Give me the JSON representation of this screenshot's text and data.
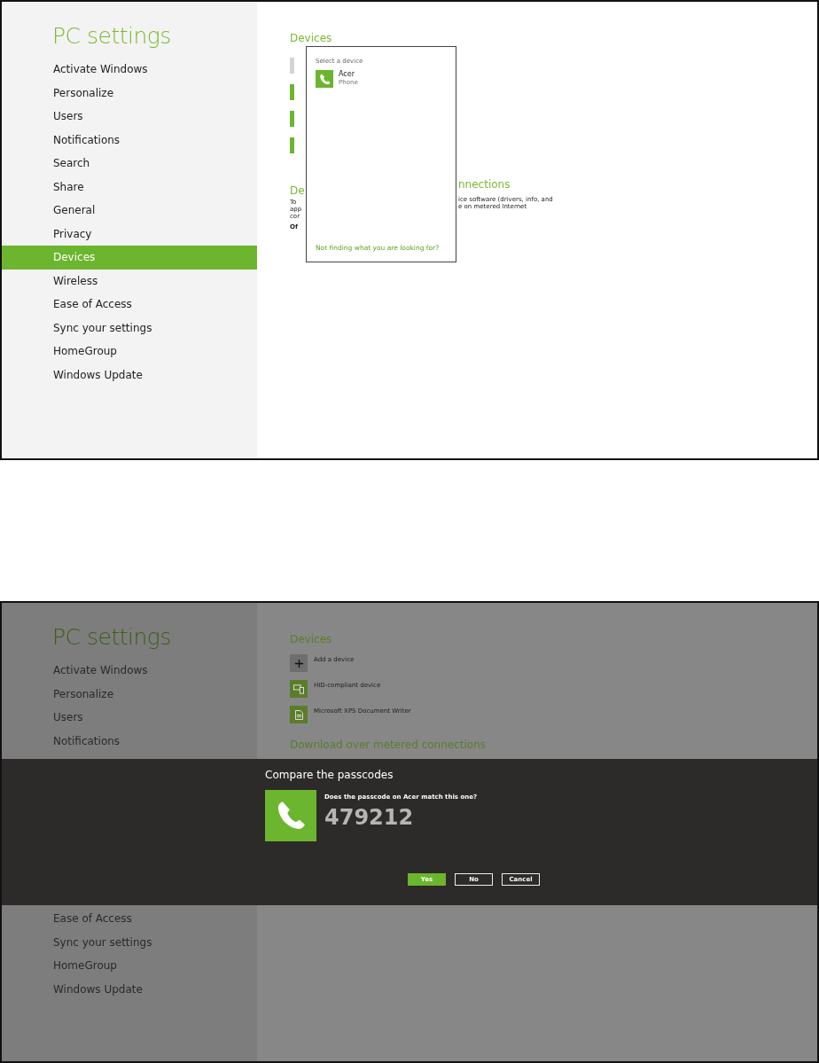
{
  "select_device_screen": {
    "title": "PC settings",
    "sidebar": {
      "items": [
        {
          "label": "Activate Windows",
          "selected": false
        },
        {
          "label": "Personalize",
          "selected": false
        },
        {
          "label": "Users",
          "selected": false
        },
        {
          "label": "Notifications",
          "selected": false
        },
        {
          "label": "Search",
          "selected": false
        },
        {
          "label": "Share",
          "selected": false
        },
        {
          "label": "General",
          "selected": false
        },
        {
          "label": "Privacy",
          "selected": false
        },
        {
          "label": "Devices",
          "selected": true
        },
        {
          "label": "Wireless",
          "selected": false
        },
        {
          "label": "Ease of Access",
          "selected": false
        },
        {
          "label": "Sync your settings",
          "selected": false
        },
        {
          "label": "HomeGroup",
          "selected": false
        },
        {
          "label": "Windows Update",
          "selected": false
        }
      ]
    },
    "main": {
      "heading": "Devices",
      "device_tiles": [
        {
          "kind": "add"
        },
        {
          "kind": "device"
        },
        {
          "kind": "device"
        },
        {
          "kind": "device"
        }
      ],
      "section_heading_parts": [
        "De",
        "nnections"
      ],
      "paragraph_left_parts": [
        "To",
        "app",
        "cor",
        "Of"
      ],
      "paragraph_right_parts": [
        "ice software (drivers, info, and",
        "e on metered Internet"
      ]
    },
    "flyout": {
      "title": "Select a device",
      "devices": [
        {
          "name": "Acer",
          "type": "Phone"
        }
      ],
      "link": "Not finding what you are looking for?"
    }
  },
  "passcode_screen": {
    "title": "PC settings",
    "sidebar": {
      "items_above": [
        {
          "label": "Activate Windows",
          "selected": false
        },
        {
          "label": "Personalize",
          "selected": false
        },
        {
          "label": "Users",
          "selected": false
        },
        {
          "label": "Notifications",
          "selected": false
        }
      ],
      "items_below": [
        {
          "label": "Ease of Access",
          "selected": false
        },
        {
          "label": "Sync your settings",
          "selected": false
        },
        {
          "label": "HomeGroup",
          "selected": false
        },
        {
          "label": "Windows Update",
          "selected": false
        }
      ]
    },
    "main": {
      "heading": "Devices",
      "devices": [
        {
          "kind": "add",
          "name": "Add a device"
        },
        {
          "kind": "device",
          "name": "HID-compliant device"
        },
        {
          "kind": "printer",
          "name": "Microsoft XPS Document Writer"
        }
      ],
      "section_heading": "Download over metered connections"
    },
    "dialog": {
      "title": "Compare the passcodes",
      "prompt": "Does the passcode on Acer match this one?",
      "passcode": "479212",
      "buttons": [
        {
          "label": "Yes",
          "default": true
        },
        {
          "label": "No",
          "default": false
        },
        {
          "label": "Cancel",
          "default": false
        }
      ]
    }
  }
}
